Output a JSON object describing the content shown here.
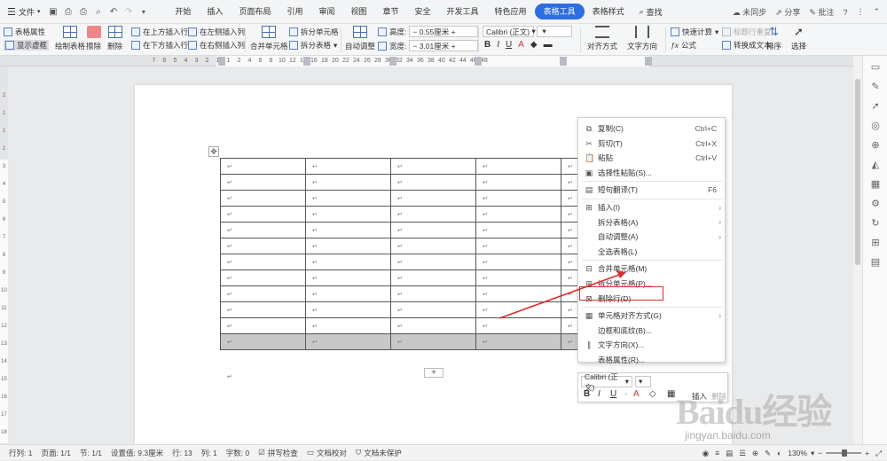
{
  "app": {
    "file_menu": "文件",
    "tabs": [
      "开始",
      "插入",
      "页面布局",
      "引用",
      "审阅",
      "视图",
      "章节",
      "安全",
      "开发工具",
      "特色应用",
      "表格工具",
      "表格样式"
    ],
    "active_tab": "表格工具",
    "search": "查找",
    "right": {
      "sync": "未同步",
      "share": "分享",
      "comment": "批注"
    }
  },
  "ribbon": {
    "table_props": "表格属性",
    "show_gridlines": "显示虚框",
    "draw_table": "绘制表格",
    "erase": "擦除",
    "delete": "删除",
    "summary": "汇总",
    "insert_above": "在上方插入行",
    "insert_below": "在下方插入行",
    "insert_left": "在左侧插入列",
    "insert_right": "在右侧插入列",
    "merge_cells": "合并单元格",
    "split_cells": "拆分单元格",
    "split_table": "拆分表格",
    "auto_adjust": "自动调整",
    "height_label": "高度:",
    "height_value": "0.55厘米",
    "width_label": "宽度:",
    "width_value": "3.01厘米",
    "font": "Calibri (正文)",
    "font_size": "",
    "bold": "B",
    "italic": "I",
    "underline": "U",
    "align": "对齐方式",
    "text_direction": "文字方向",
    "quick_calc": "快速计算",
    "repeat_header": "标题行重复",
    "formula": "公式",
    "convert_text": "转换成文本",
    "sort": "排序",
    "select": "选择"
  },
  "ruler_top": [
    "7",
    "6",
    "5",
    "4",
    "3",
    "2",
    "1",
    "1",
    "2",
    "4",
    "6",
    "8",
    "10",
    "12",
    "14",
    "16",
    "18",
    "20",
    "22",
    "24",
    "26",
    "28",
    "30",
    "32",
    "34",
    "36",
    "38",
    "40",
    "42",
    "44",
    "46",
    "48"
  ],
  "ruler_left": [
    "2",
    "1",
    "1",
    "2",
    "3",
    "4",
    "5",
    "6",
    "7",
    "8",
    "9",
    "10",
    "11",
    "12",
    "13",
    "14",
    "15",
    "16",
    "17",
    "18"
  ],
  "table": {
    "rows": 12,
    "cols": 5,
    "cell_mark": "↵",
    "selected_row_index": 11
  },
  "context_menu": [
    {
      "icon": "copy-icon",
      "glyph": "⧉",
      "label": "复制(C)",
      "shortcut": "Ctrl+C",
      "group": 0
    },
    {
      "icon": "cut-icon",
      "glyph": "✂",
      "label": "剪切(T)",
      "shortcut": "Ctrl+X",
      "group": 0
    },
    {
      "icon": "paste-icon",
      "glyph": "📋",
      "label": "粘贴",
      "shortcut": "Ctrl+V",
      "group": 0
    },
    {
      "icon": "paste-special-icon",
      "glyph": "▣",
      "label": "选择性粘贴(S)...",
      "shortcut": "",
      "group": 0
    },
    {
      "icon": "translate-icon",
      "glyph": "▤",
      "label": "短句翻译(T)",
      "shortcut": "F6",
      "group": 1
    },
    {
      "icon": "insert-icon",
      "glyph": "⊞",
      "label": "插入(I)",
      "shortcut": "",
      "submenu": true,
      "group": 2
    },
    {
      "icon": "",
      "glyph": "",
      "label": "拆分表格(A)",
      "shortcut": "",
      "submenu": true,
      "group": 2
    },
    {
      "icon": "",
      "glyph": "",
      "label": "自动调整(A)",
      "shortcut": "",
      "submenu": true,
      "group": 2
    },
    {
      "icon": "",
      "glyph": "",
      "label": "全选表格(L)",
      "shortcut": "",
      "group": 2
    },
    {
      "icon": "merge-cells-icon",
      "glyph": "⊟",
      "label": "合并单元格(M)",
      "shortcut": "",
      "group": 3
    },
    {
      "icon": "split-cells-icon",
      "glyph": "⊞",
      "label": "拆分单元格(P)...",
      "shortcut": "",
      "group": 3
    },
    {
      "icon": "delete-row-icon",
      "glyph": "⊠",
      "label": "删除行(D)",
      "shortcut": "",
      "group": 3
    },
    {
      "icon": "cell-align-icon",
      "glyph": "▦",
      "label": "单元格对齐方式(G)",
      "shortcut": "",
      "submenu": true,
      "group": 4
    },
    {
      "icon": "",
      "glyph": "",
      "label": "边框和底纹(B)...",
      "shortcut": "",
      "group": 4
    },
    {
      "icon": "text-direction-icon",
      "glyph": "∥",
      "label": "文字方向(X)...",
      "shortcut": "",
      "group": 4
    },
    {
      "icon": "",
      "glyph": "",
      "label": "表格属性(R)...",
      "shortcut": "",
      "group": 4
    }
  ],
  "mini_toolbar": {
    "font": "Calibri (正文)",
    "bold": "B",
    "italic": "I",
    "underline": "U",
    "font_color": "A",
    "insert": "插入",
    "delete": "删除"
  },
  "status": {
    "row_col": "行列: 1",
    "page": "页面: 1/1",
    "section": "节: 1/1",
    "setting": "设置值: 9.3厘米",
    "row": "行: 13",
    "col": "列: 1",
    "words": "字数: 0",
    "spell": "拼写检查",
    "proof": "文档校对",
    "protect": "文档未保护",
    "zoom": "130%"
  },
  "watermark": {
    "logo": "Baidu经验",
    "url": "jingyan.baidu.com"
  },
  "colors": {
    "accent": "#2c6ee0",
    "highlight": "#d9302c"
  }
}
